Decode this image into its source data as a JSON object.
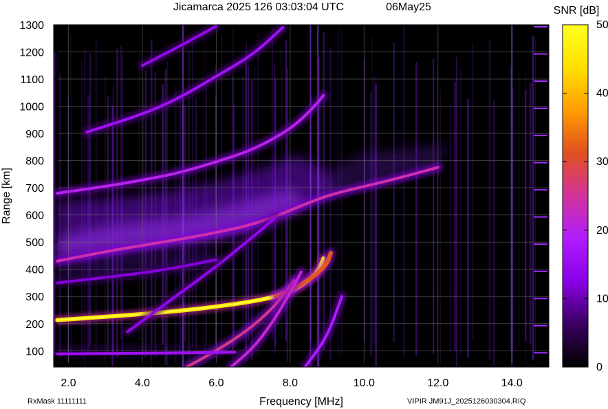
{
  "chart_data": {
    "type": "heatmap",
    "title": "Jicamarca 2025 126 03:03:04 UTC",
    "date_label": "06May25",
    "xlabel": "Frequency [MHz]",
    "ylabel": "Range [km]",
    "xlim": [
      1.6,
      15.0
    ],
    "ylim": [
      40,
      1300
    ],
    "x_ticks": [
      2.0,
      4.0,
      6.0,
      8.0,
      10.0,
      12.0,
      14.0
    ],
    "x_tick_labels": [
      "2.0",
      "4.0",
      "6.0",
      "8.0",
      "10.0",
      "12.0",
      "14.0"
    ],
    "y_ticks": [
      100,
      200,
      300,
      400,
      500,
      600,
      700,
      800,
      900,
      1000,
      1100,
      1200,
      1300
    ],
    "y_tick_labels": [
      "100",
      "200",
      "300",
      "400",
      "500",
      "600",
      "700",
      "800",
      "900",
      "1000",
      "1100",
      "1200",
      "1300"
    ],
    "grid": true,
    "colorbar": {
      "label": "SNR [dB]",
      "range": [
        0,
        50
      ],
      "ticks": [
        0,
        10,
        20,
        30,
        40,
        50
      ],
      "tick_labels": [
        "0",
        "10",
        "20",
        "30",
        "40",
        "50"
      ],
      "colors": [
        "#000000",
        "#3a0060",
        "#8a00e6",
        "#b01cff",
        "#d2349a",
        "#e05020",
        "#ff9c00",
        "#ffe000",
        "#ffff20"
      ]
    },
    "traces": [
      {
        "name": "",
        "snr_db": 44,
        "points": [
          [
            1.7,
            213
          ],
          [
            3,
            225
          ],
          [
            4,
            235
          ],
          [
            5,
            247
          ],
          [
            6,
            262
          ],
          [
            7,
            282
          ],
          [
            7.7,
            302
          ],
          [
            8.2,
            330
          ],
          [
            8.6,
            370
          ],
          [
            8.8,
            405
          ],
          [
            8.9,
            440
          ]
        ]
      },
      {
        "name": "",
        "snr_db": 32,
        "points": [
          [
            7.6,
            300
          ],
          [
            8.2,
            335
          ],
          [
            8.7,
            380
          ],
          [
            9.0,
            420
          ],
          [
            9.1,
            460
          ]
        ]
      },
      {
        "name": "",
        "snr_db": 24,
        "points": [
          [
            1.7,
            430
          ],
          [
            3,
            465
          ],
          [
            4,
            488
          ],
          [
            5,
            510
          ],
          [
            6,
            535
          ],
          [
            7,
            565
          ],
          [
            7.8,
            605
          ],
          [
            8.4,
            640
          ],
          [
            9.2,
            680
          ],
          [
            10.5,
            720
          ],
          [
            12,
            775
          ]
        ]
      },
      {
        "name": "",
        "snr_db": 20,
        "points": [
          [
            1.7,
            680
          ],
          [
            3,
            705
          ],
          [
            4,
            728
          ],
          [
            5,
            755
          ],
          [
            6,
            795
          ],
          [
            7,
            840
          ],
          [
            8,
            915
          ],
          [
            8.6,
            990
          ],
          [
            8.9,
            1040
          ]
        ]
      },
      {
        "name": "",
        "snr_db": 16,
        "points": [
          [
            2.5,
            905
          ],
          [
            4,
            970
          ],
          [
            5,
            1030
          ],
          [
            6,
            1110
          ],
          [
            7,
            1190
          ],
          [
            7.8,
            1290
          ]
        ]
      },
      {
        "name": "",
        "snr_db": 14,
        "points": [
          [
            4,
            1150
          ],
          [
            5,
            1220
          ],
          [
            6,
            1295
          ]
        ]
      },
      {
        "name": "",
        "snr_db": 26,
        "points": [
          [
            5.2,
            40
          ],
          [
            6,
            100
          ],
          [
            6.8,
            170
          ],
          [
            7.4,
            240
          ],
          [
            7.8,
            300
          ],
          [
            8.1,
            360
          ]
        ]
      },
      {
        "name": "",
        "snr_db": 22,
        "points": [
          [
            6.4,
            40
          ],
          [
            7,
            110
          ],
          [
            7.5,
            200
          ],
          [
            7.9,
            290
          ],
          [
            8.3,
            390
          ]
        ]
      },
      {
        "name": "",
        "snr_db": 14,
        "points": [
          [
            3.6,
            170
          ],
          [
            5,
            310
          ],
          [
            6,
            410
          ],
          [
            7,
            520
          ],
          [
            7.6,
            590
          ]
        ]
      },
      {
        "name": "",
        "snr_db": 12,
        "points": [
          [
            1.7,
            350
          ],
          [
            3,
            370
          ],
          [
            4.5,
            395
          ],
          [
            6,
            435
          ]
        ]
      },
      {
        "name": "",
        "snr_db": 16,
        "points": [
          [
            1.7,
            88
          ],
          [
            3,
            90
          ],
          [
            5,
            92
          ],
          [
            6.5,
            95
          ]
        ]
      },
      {
        "name": "",
        "snr_db": 18,
        "points": [
          [
            8.4,
            40
          ],
          [
            9.0,
            150
          ],
          [
            9.4,
            300
          ]
        ]
      }
    ]
  },
  "footer": {
    "rx_mask": "RxMask 11111111",
    "file_info": "VIPIR  JM91J_2025126030304.RIQ"
  }
}
